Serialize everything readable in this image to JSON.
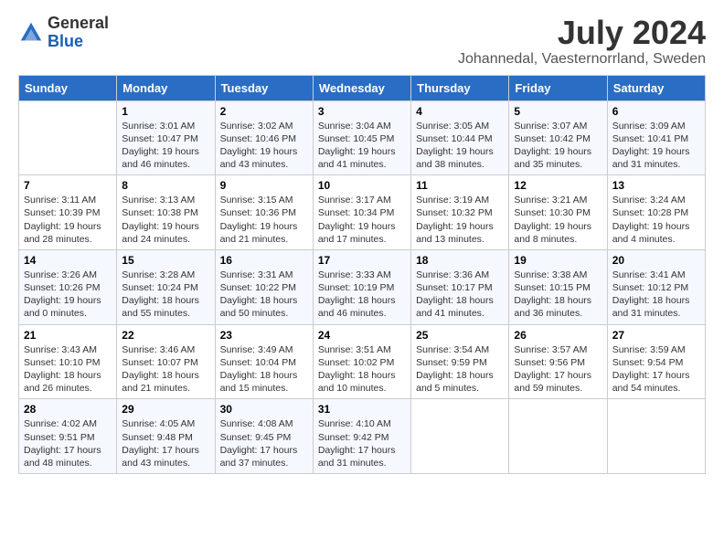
{
  "logo": {
    "general": "General",
    "blue": "Blue"
  },
  "title": "July 2024",
  "location": "Johannedal, Vaesternorrland, Sweden",
  "header_days": [
    "Sunday",
    "Monday",
    "Tuesday",
    "Wednesday",
    "Thursday",
    "Friday",
    "Saturday"
  ],
  "weeks": [
    [
      {
        "day": "",
        "sunrise": "",
        "sunset": "",
        "daylight": ""
      },
      {
        "day": "1",
        "sunrise": "Sunrise: 3:01 AM",
        "sunset": "Sunset: 10:47 PM",
        "daylight": "Daylight: 19 hours and 46 minutes."
      },
      {
        "day": "2",
        "sunrise": "Sunrise: 3:02 AM",
        "sunset": "Sunset: 10:46 PM",
        "daylight": "Daylight: 19 hours and 43 minutes."
      },
      {
        "day": "3",
        "sunrise": "Sunrise: 3:04 AM",
        "sunset": "Sunset: 10:45 PM",
        "daylight": "Daylight: 19 hours and 41 minutes."
      },
      {
        "day": "4",
        "sunrise": "Sunrise: 3:05 AM",
        "sunset": "Sunset: 10:44 PM",
        "daylight": "Daylight: 19 hours and 38 minutes."
      },
      {
        "day": "5",
        "sunrise": "Sunrise: 3:07 AM",
        "sunset": "Sunset: 10:42 PM",
        "daylight": "Daylight: 19 hours and 35 minutes."
      },
      {
        "day": "6",
        "sunrise": "Sunrise: 3:09 AM",
        "sunset": "Sunset: 10:41 PM",
        "daylight": "Daylight: 19 hours and 31 minutes."
      }
    ],
    [
      {
        "day": "7",
        "sunrise": "Sunrise: 3:11 AM",
        "sunset": "Sunset: 10:39 PM",
        "daylight": "Daylight: 19 hours and 28 minutes."
      },
      {
        "day": "8",
        "sunrise": "Sunrise: 3:13 AM",
        "sunset": "Sunset: 10:38 PM",
        "daylight": "Daylight: 19 hours and 24 minutes."
      },
      {
        "day": "9",
        "sunrise": "Sunrise: 3:15 AM",
        "sunset": "Sunset: 10:36 PM",
        "daylight": "Daylight: 19 hours and 21 minutes."
      },
      {
        "day": "10",
        "sunrise": "Sunrise: 3:17 AM",
        "sunset": "Sunset: 10:34 PM",
        "daylight": "Daylight: 19 hours and 17 minutes."
      },
      {
        "day": "11",
        "sunrise": "Sunrise: 3:19 AM",
        "sunset": "Sunset: 10:32 PM",
        "daylight": "Daylight: 19 hours and 13 minutes."
      },
      {
        "day": "12",
        "sunrise": "Sunrise: 3:21 AM",
        "sunset": "Sunset: 10:30 PM",
        "daylight": "Daylight: 19 hours and 8 minutes."
      },
      {
        "day": "13",
        "sunrise": "Sunrise: 3:24 AM",
        "sunset": "Sunset: 10:28 PM",
        "daylight": "Daylight: 19 hours and 4 minutes."
      }
    ],
    [
      {
        "day": "14",
        "sunrise": "Sunrise: 3:26 AM",
        "sunset": "Sunset: 10:26 PM",
        "daylight": "Daylight: 19 hours and 0 minutes."
      },
      {
        "day": "15",
        "sunrise": "Sunrise: 3:28 AM",
        "sunset": "Sunset: 10:24 PM",
        "daylight": "Daylight: 18 hours and 55 minutes."
      },
      {
        "day": "16",
        "sunrise": "Sunrise: 3:31 AM",
        "sunset": "Sunset: 10:22 PM",
        "daylight": "Daylight: 18 hours and 50 minutes."
      },
      {
        "day": "17",
        "sunrise": "Sunrise: 3:33 AM",
        "sunset": "Sunset: 10:19 PM",
        "daylight": "Daylight: 18 hours and 46 minutes."
      },
      {
        "day": "18",
        "sunrise": "Sunrise: 3:36 AM",
        "sunset": "Sunset: 10:17 PM",
        "daylight": "Daylight: 18 hours and 41 minutes."
      },
      {
        "day": "19",
        "sunrise": "Sunrise: 3:38 AM",
        "sunset": "Sunset: 10:15 PM",
        "daylight": "Daylight: 18 hours and 36 minutes."
      },
      {
        "day": "20",
        "sunrise": "Sunrise: 3:41 AM",
        "sunset": "Sunset: 10:12 PM",
        "daylight": "Daylight: 18 hours and 31 minutes."
      }
    ],
    [
      {
        "day": "21",
        "sunrise": "Sunrise: 3:43 AM",
        "sunset": "Sunset: 10:10 PM",
        "daylight": "Daylight: 18 hours and 26 minutes."
      },
      {
        "day": "22",
        "sunrise": "Sunrise: 3:46 AM",
        "sunset": "Sunset: 10:07 PM",
        "daylight": "Daylight: 18 hours and 21 minutes."
      },
      {
        "day": "23",
        "sunrise": "Sunrise: 3:49 AM",
        "sunset": "Sunset: 10:04 PM",
        "daylight": "Daylight: 18 hours and 15 minutes."
      },
      {
        "day": "24",
        "sunrise": "Sunrise: 3:51 AM",
        "sunset": "Sunset: 10:02 PM",
        "daylight": "Daylight: 18 hours and 10 minutes."
      },
      {
        "day": "25",
        "sunrise": "Sunrise: 3:54 AM",
        "sunset": "Sunset: 9:59 PM",
        "daylight": "Daylight: 18 hours and 5 minutes."
      },
      {
        "day": "26",
        "sunrise": "Sunrise: 3:57 AM",
        "sunset": "Sunset: 9:56 PM",
        "daylight": "Daylight: 17 hours and 59 minutes."
      },
      {
        "day": "27",
        "sunrise": "Sunrise: 3:59 AM",
        "sunset": "Sunset: 9:54 PM",
        "daylight": "Daylight: 17 hours and 54 minutes."
      }
    ],
    [
      {
        "day": "28",
        "sunrise": "Sunrise: 4:02 AM",
        "sunset": "Sunset: 9:51 PM",
        "daylight": "Daylight: 17 hours and 48 minutes."
      },
      {
        "day": "29",
        "sunrise": "Sunrise: 4:05 AM",
        "sunset": "Sunset: 9:48 PM",
        "daylight": "Daylight: 17 hours and 43 minutes."
      },
      {
        "day": "30",
        "sunrise": "Sunrise: 4:08 AM",
        "sunset": "Sunset: 9:45 PM",
        "daylight": "Daylight: 17 hours and 37 minutes."
      },
      {
        "day": "31",
        "sunrise": "Sunrise: 4:10 AM",
        "sunset": "Sunset: 9:42 PM",
        "daylight": "Daylight: 17 hours and 31 minutes."
      },
      {
        "day": "",
        "sunrise": "",
        "sunset": "",
        "daylight": ""
      },
      {
        "day": "",
        "sunrise": "",
        "sunset": "",
        "daylight": ""
      },
      {
        "day": "",
        "sunrise": "",
        "sunset": "",
        "daylight": ""
      }
    ]
  ]
}
